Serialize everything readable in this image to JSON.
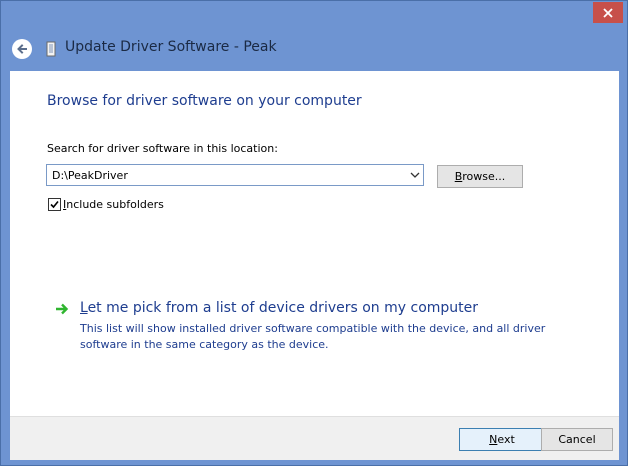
{
  "window": {
    "title": "Update Driver Software - Peak"
  },
  "content": {
    "heading": "Browse for driver software on your computer",
    "location_label_prefix": "",
    "location_label": "Search for driver software in this location:",
    "location_value": "D:\\PeakDriver",
    "browse_label_first": "B",
    "browse_label_rest": "rowse...",
    "include_subfolders_checked": true,
    "include_subfolders_first": "I",
    "include_subfolders_rest": "nclude subfolders",
    "pick_link_first": "L",
    "pick_link_rest": "et me pick from a list of device drivers on my computer",
    "pick_description": "This list will show installed driver software compatible with the device, and all driver software in the same category as the device."
  },
  "footer": {
    "next_first": "N",
    "next_rest": "ext",
    "cancel_label": "Cancel"
  },
  "colors": {
    "frame": "#6e94d2",
    "accent_text": "#1e3d8f",
    "close_button": "#c7504a",
    "pick_arrow": "#2fb52f"
  },
  "icons": {
    "close": "close-icon",
    "back": "back-arrow-icon",
    "app": "driver-device-icon",
    "checkbox": "checkmark-icon",
    "combo": "chevron-down-icon",
    "pick": "green-arrow-icon"
  }
}
